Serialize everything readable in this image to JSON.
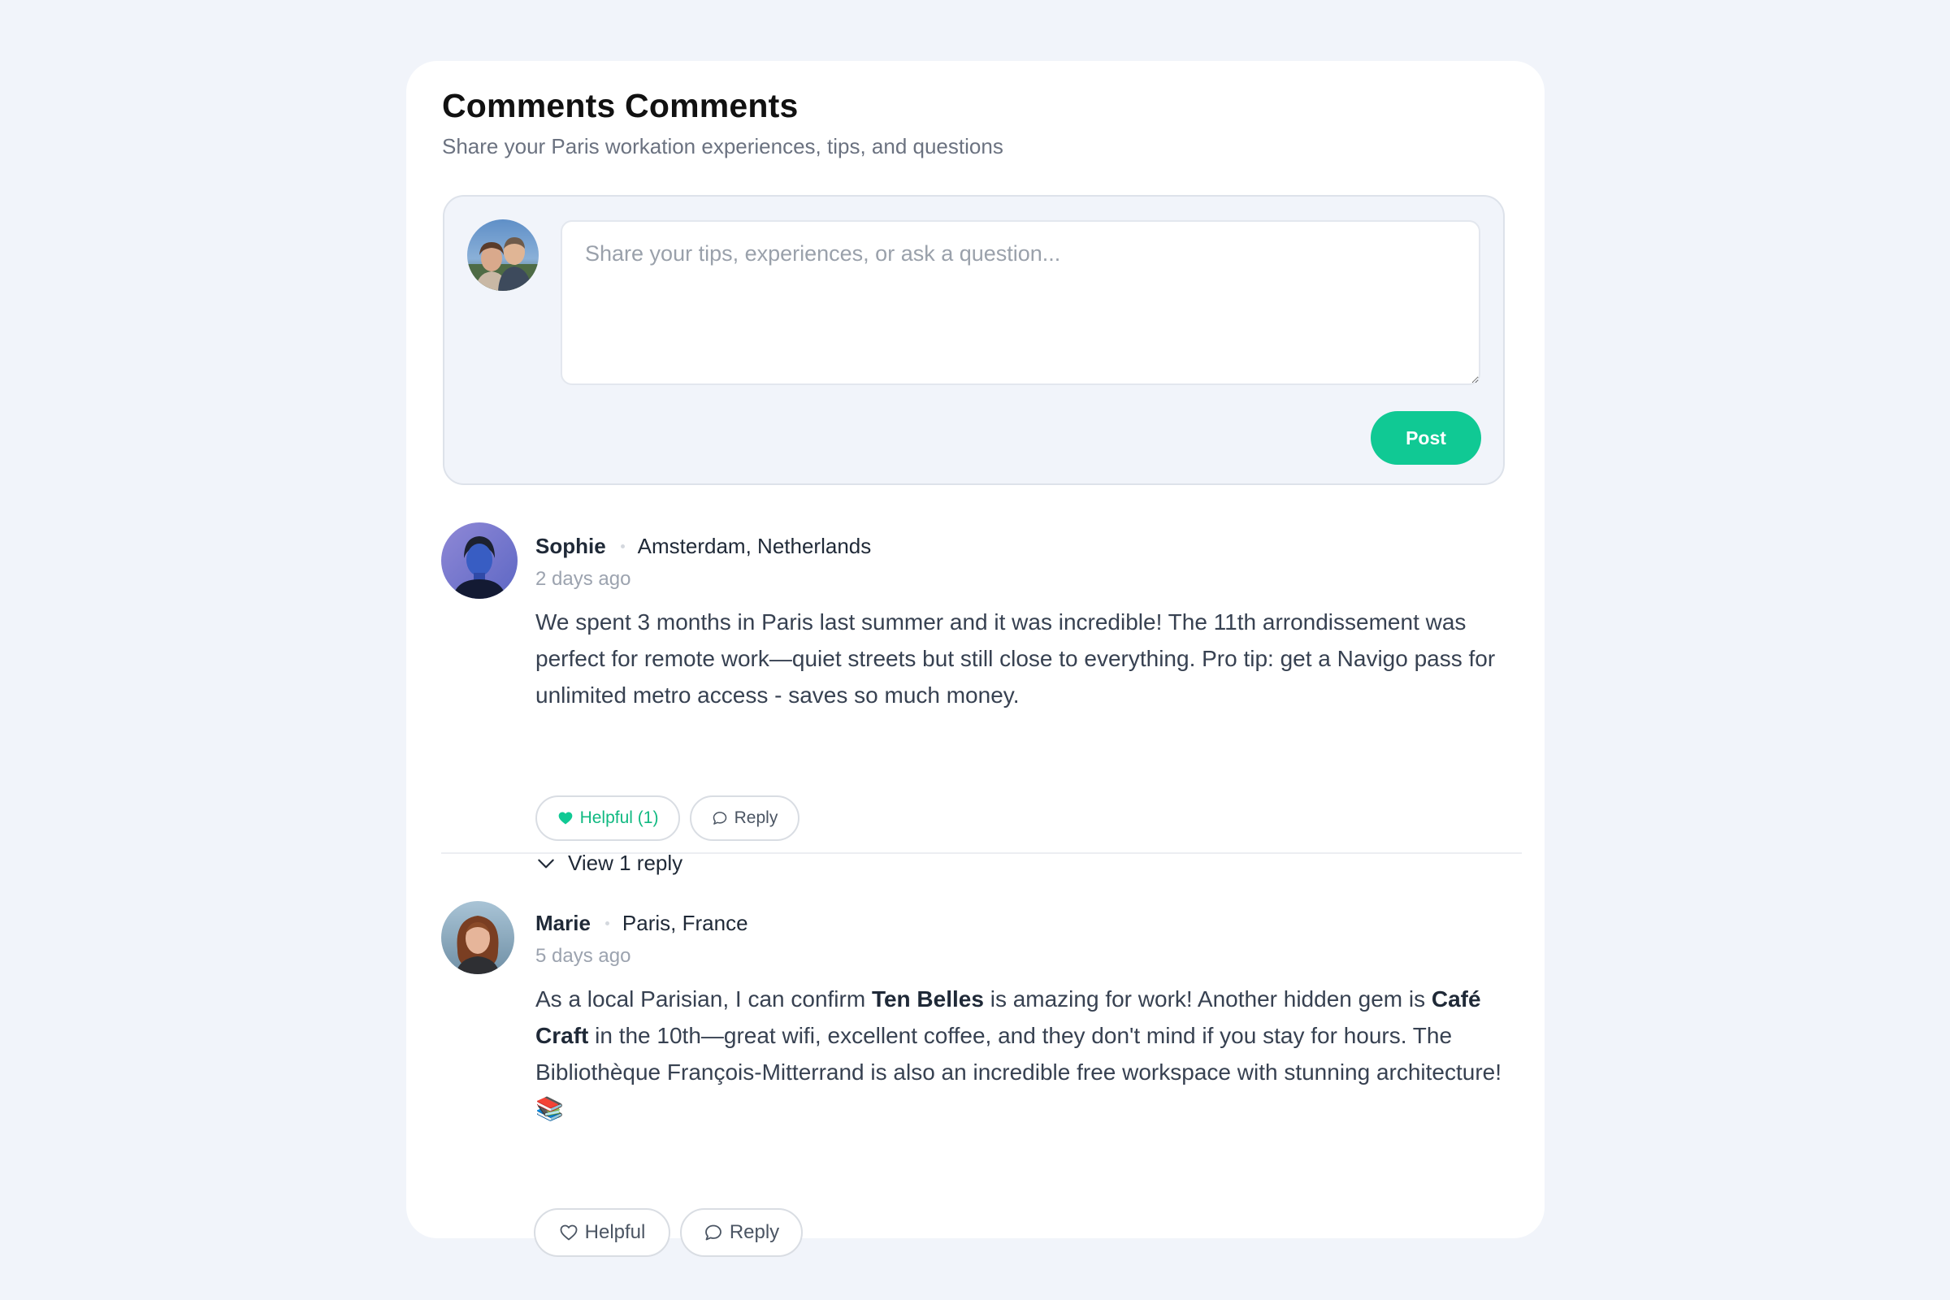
{
  "section": {
    "title": "Comments Comments",
    "subtitle": "Share your Paris workation experiences, tips, and questions"
  },
  "composer": {
    "placeholder": "Share your tips, experiences, or ask a question...",
    "value": "",
    "post_label": "Post",
    "avatar_icon": "user-couple-photo"
  },
  "comments": [
    {
      "author": "Sophie",
      "location": "Amsterdam, Netherlands",
      "time": "2 days ago",
      "body": "We spent 3 months in Paris last summer and it was incredible! The 11th arrondissement was perfect for remote work—quiet streets but still close to everything. Pro tip: get a Navigo pass for unlimited metro access - saves so much money.",
      "helpful_label": "Helpful (1)",
      "helpful_active": true,
      "reply_label": "Reply",
      "view_replies_label": "View 1 reply"
    },
    {
      "author": "Marie",
      "location": "Paris, France",
      "time": "5 days ago",
      "body_parts": [
        "As a local Parisian, I can confirm ",
        "Ten Belles",
        " is amazing for work! Another hidden gem is ",
        "Café Craft",
        " in the 10th—great wifi, excellent coffee, and they don't mind if you stay for hours. The Bibliothèque François-Mitterrand is also an incredible free workspace with stunning architecture! ",
        "📚"
      ],
      "helpful_label": "Helpful",
      "helpful_active": false,
      "reply_label": "Reply"
    }
  ],
  "colors": {
    "page_bg": "#f1f4fa",
    "card_bg": "#ffffff",
    "accent": "#10c994",
    "helpful_active": "#10b981",
    "muted_text": "#9ca3af"
  },
  "icons": {
    "helpful_active": "heart-filled-icon",
    "helpful": "heart-outline-icon",
    "reply": "speech-bubble-icon",
    "expand": "chevron-down-icon"
  }
}
